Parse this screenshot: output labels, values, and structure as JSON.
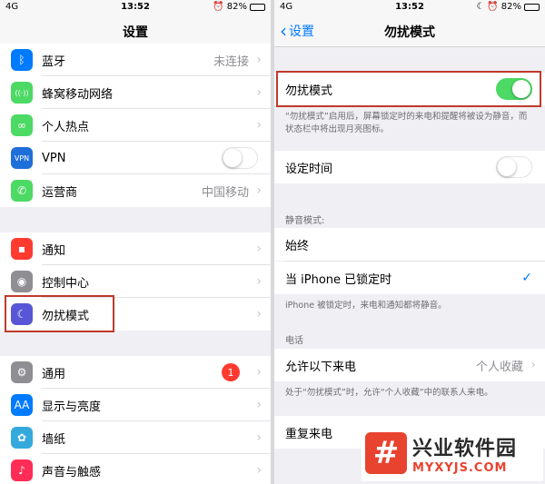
{
  "status": {
    "carrier": "4G",
    "time": "13:52",
    "battery": "82%",
    "battery_fraction": 0.82
  },
  "left": {
    "title": "设置",
    "rows": [
      {
        "label": "蓝牙",
        "value": "未连接",
        "icon": "bluetooth-icon",
        "color": "#007aff"
      },
      {
        "label": "蜂窝移动网络",
        "icon": "antenna-icon",
        "color": "#4cd964"
      },
      {
        "label": "个人热点",
        "icon": "hotspot-icon",
        "color": "#4cd964"
      },
      {
        "label": "VPN",
        "icon": "vpn-icon",
        "color": "#1e6fd9",
        "toggle": false
      },
      {
        "label": "运营商",
        "value": "中国移动",
        "icon": "phone-icon",
        "color": "#4cd964"
      },
      {
        "label": "通知",
        "icon": "notification-icon",
        "color": "#ff3b30"
      },
      {
        "label": "控制中心",
        "icon": "control-center-icon",
        "color": "#8e8e93"
      },
      {
        "label": "勿扰模式",
        "icon": "moon-icon",
        "color": "#5856d6"
      },
      {
        "label": "通用",
        "badge": "1",
        "icon": "gear-icon",
        "color": "#8e8e93"
      },
      {
        "label": "显示与亮度",
        "icon": "display-icon",
        "color": "#007aff"
      },
      {
        "label": "墙纸",
        "icon": "wallpaper-icon",
        "color": "#34aadc"
      },
      {
        "label": "声音与触感",
        "icon": "sound-icon",
        "color": "#ff2d55"
      }
    ]
  },
  "right": {
    "back_label": "设置",
    "title": "勿扰模式",
    "dnd_label": "勿扰模式",
    "dnd_on": true,
    "dnd_note": "“勿扰模式”启用后，屏幕锁定时的来电和提醒将被设为静音，而状态栏中将出现月亮图标。",
    "schedule_label": "设定时间",
    "schedule_on": false,
    "silence_header": "静音模式:",
    "always_label": "始终",
    "locked_label": "当 iPhone 已锁定时",
    "locked_note": "iPhone 被锁定时，来电和通知都将静音。",
    "phone_header": "电话",
    "allow_label": "允许以下来电",
    "allow_value": "个人收藏",
    "allow_note": "处于“勿扰模式”时，允许“个人收藏”中的联系人来电。",
    "repeat_label": "重复来电"
  },
  "watermark": {
    "cn": "兴业软件园",
    "en": "MYXYJS.COM"
  },
  "colors": {
    "accent": "#007aff",
    "toggle_on": "#4cd964",
    "highlight": "#c0392b"
  }
}
